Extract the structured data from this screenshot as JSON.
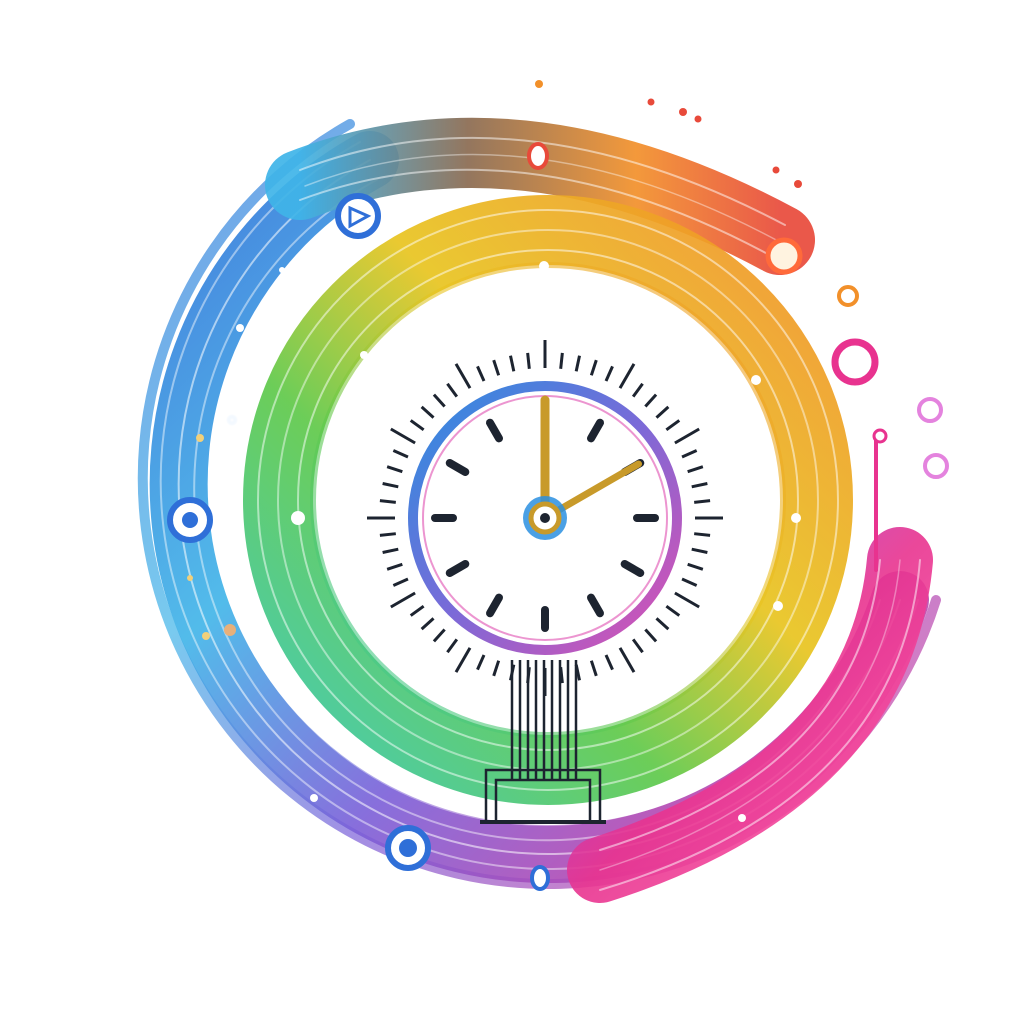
{
  "artwork": {
    "subject": "clock-icon",
    "palette": {
      "background": "#ffffff",
      "blue": "#2f6fd8",
      "cyan": "#3fb4e8",
      "teal": "#35c7b0",
      "green": "#5fc94a",
      "yellow": "#e8c41f",
      "orange": "#f2902a",
      "red": "#e84a3a",
      "magenta": "#e8338f",
      "pink": "#d94fd0",
      "clock_rim": "#2a8fe0",
      "clock_rim_inner": "#e04fb0",
      "clock_face": "#ffffff",
      "clock_marks": "#1d2430",
      "hand_gold": "#c89a2a"
    },
    "clock": {
      "hour_marks": 12,
      "minute_ticks": 60,
      "hour_hand_angle_deg": 0,
      "minute_hand_angle_deg": 60
    }
  }
}
